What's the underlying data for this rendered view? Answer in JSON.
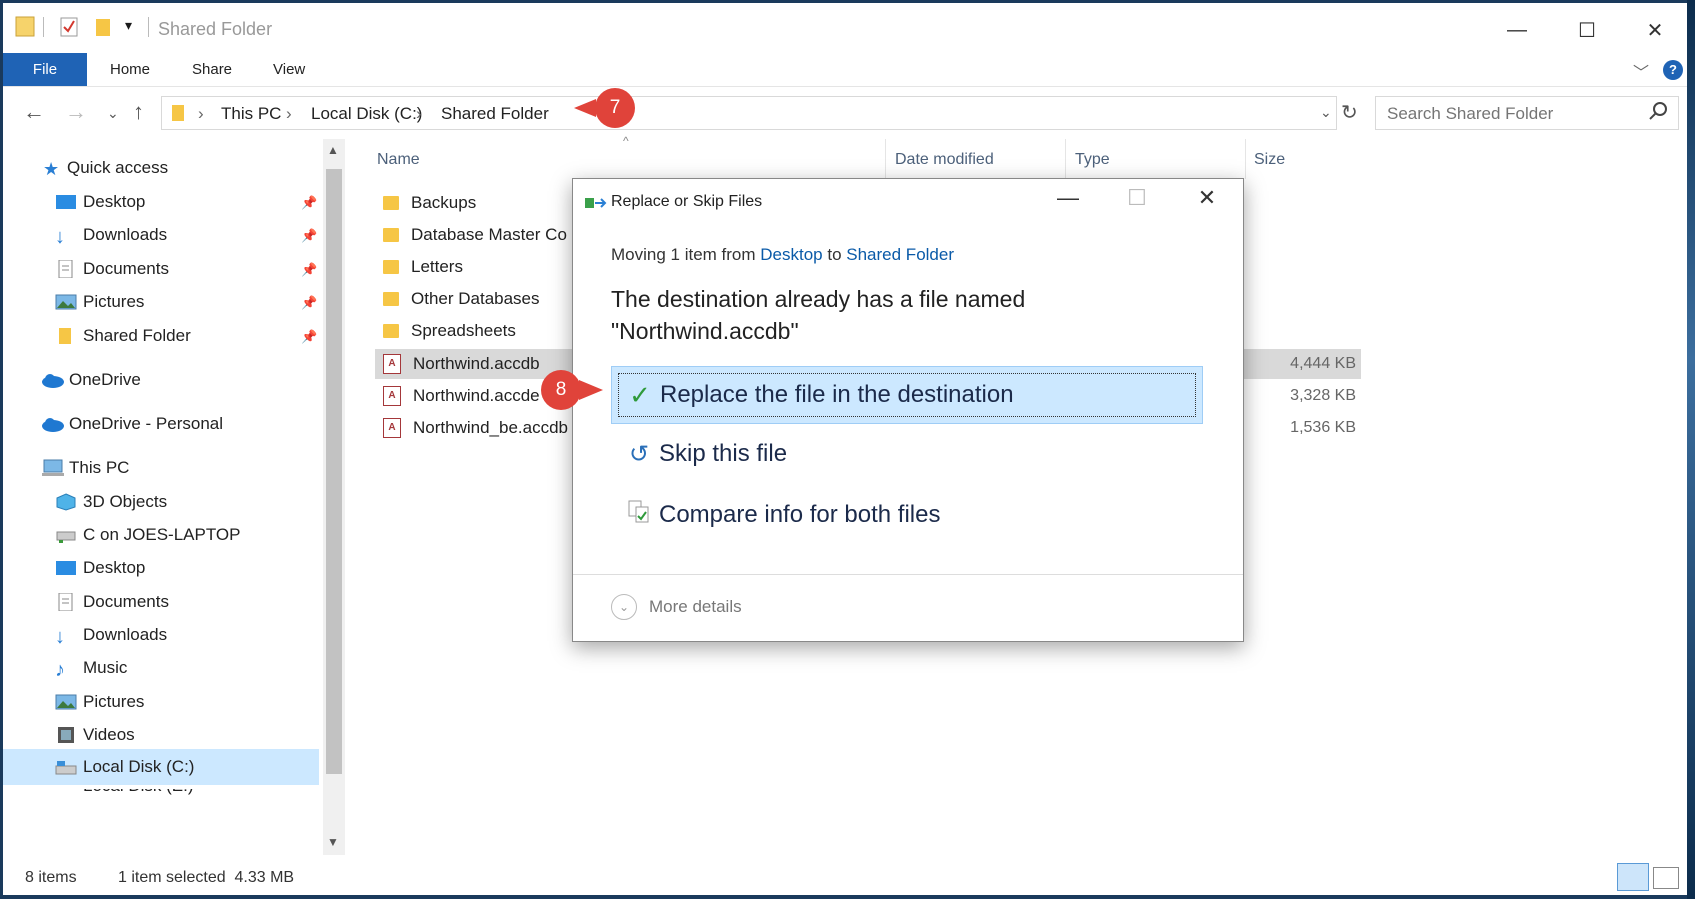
{
  "window": {
    "title": "Shared Folder",
    "controls": {
      "minimize": "—",
      "maximize": "☐",
      "close": "✕"
    }
  },
  "ribbon": {
    "tabs": [
      "File",
      "Home",
      "Share",
      "View"
    ],
    "help": "?"
  },
  "address": {
    "crumbs": [
      "This PC",
      "Local Disk (C:)",
      "Shared Folder"
    ],
    "search_placeholder": "Search Shared Folder"
  },
  "nav": {
    "quick_access": "Quick access",
    "quick_items": [
      "Desktop",
      "Downloads",
      "Documents",
      "Pictures",
      "Shared Folder"
    ],
    "onedrive": "OneDrive",
    "onedrive_personal": "OneDrive - Personal",
    "this_pc": "This PC",
    "pc_items": [
      "3D Objects",
      "C on JOES-LAPTOP",
      "Desktop",
      "Documents",
      "Downloads",
      "Music",
      "Pictures",
      "Videos",
      "Local Disk (C:)"
    ],
    "partial_item": "Local Disk (E:)"
  },
  "files": {
    "columns": [
      "Name",
      "Date modified",
      "Type",
      "Size"
    ],
    "rows": [
      {
        "name": "Backups",
        "kind": "folder",
        "size": ""
      },
      {
        "name": "Database Master Co",
        "kind": "folder",
        "size": ""
      },
      {
        "name": "Letters",
        "kind": "folder",
        "size": ""
      },
      {
        "name": "Other Databases",
        "kind": "folder",
        "size": ""
      },
      {
        "name": "Spreadsheets",
        "kind": "folder",
        "size": ""
      },
      {
        "name": "Northwind.accdb",
        "kind": "access",
        "size": "4,444 KB"
      },
      {
        "name": "Northwind.accde",
        "kind": "access",
        "size": "3,328 KB"
      },
      {
        "name": "Northwind_be.accdb",
        "kind": "access",
        "size": "1,536 KB"
      }
    ]
  },
  "status": {
    "count": "8 items",
    "selected": "1 item selected  4.33 MB"
  },
  "dialog": {
    "title": "Replace or Skip Files",
    "moving_prefix": "Moving 1 item from ",
    "from": "Desktop",
    "to_word": " to ",
    "to": "Shared Folder",
    "message_line1": "The destination already has a file named",
    "message_line2": "\"Northwind.accdb\"",
    "options": [
      "Replace the file in the destination",
      "Skip this file",
      "Compare info for both files"
    ],
    "more_details": "More details"
  },
  "callouts": {
    "step7": "7",
    "step8": "8"
  },
  "colors": {
    "accent": "#1f63b5",
    "callout": "#e0433a",
    "selection": "#cce8ff"
  }
}
